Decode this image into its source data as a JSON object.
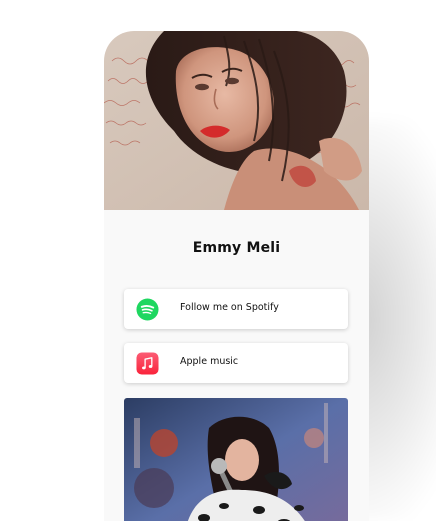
{
  "profile": {
    "name": "Emmy Meli"
  },
  "links": [
    {
      "label": "Follow me on Spotify",
      "icon": "spotify-icon",
      "color": "#1ed760"
    },
    {
      "label": "Apple music",
      "icon": "apple-music-icon",
      "color": "#fa3d55"
    }
  ],
  "colors": {
    "page_bg": "#ffffff",
    "card_bg": "#f9f9f9",
    "button_bg": "#ffffff",
    "text": "#111111"
  }
}
